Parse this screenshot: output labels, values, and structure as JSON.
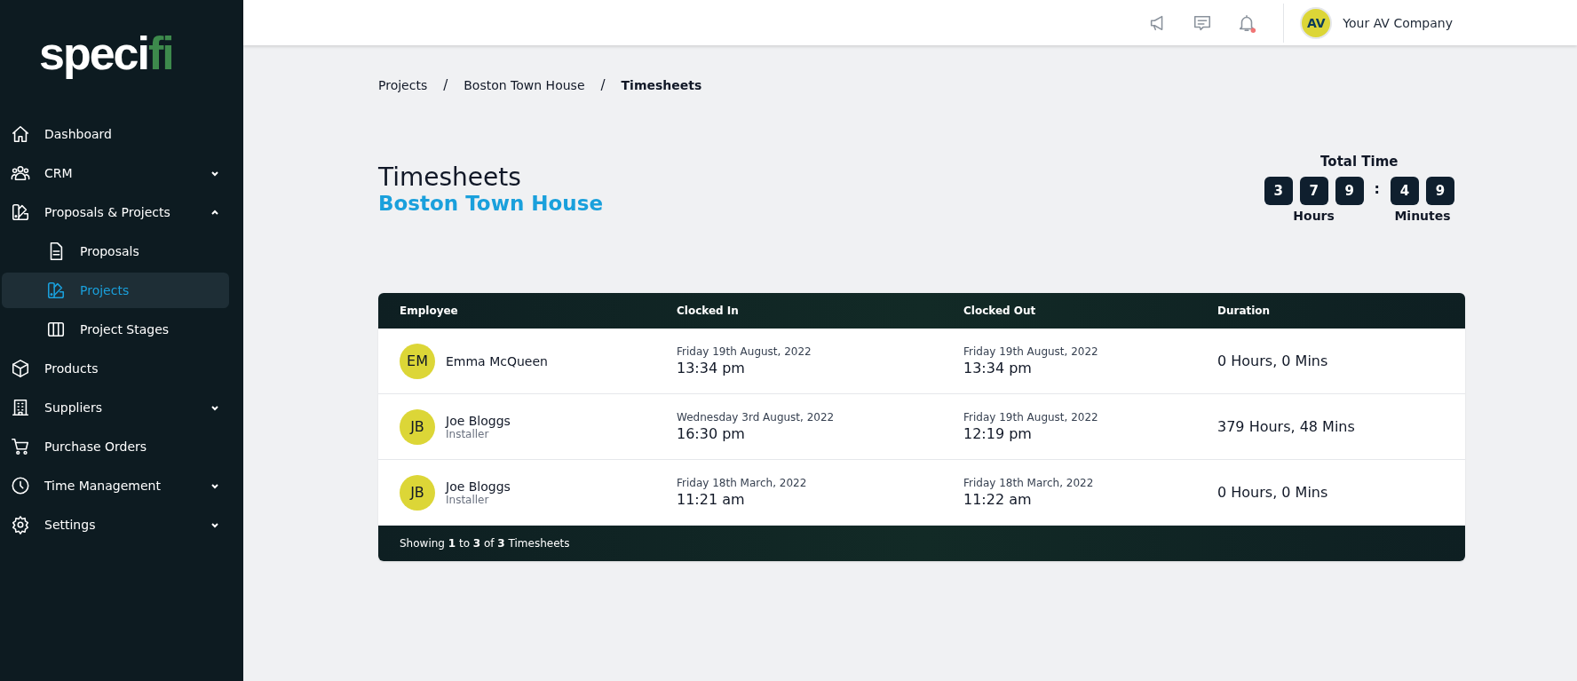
{
  "logo": {
    "text": "speci",
    "accent": "fi"
  },
  "sidebar": {
    "items": [
      {
        "label": "Dashboard",
        "kind": "home",
        "selected": false
      },
      {
        "label": "CRM",
        "kind": "users",
        "selected": false,
        "expanded": false
      },
      {
        "label": "Proposals & Projects",
        "kind": "swatch",
        "selected": false,
        "expanded": true,
        "children": [
          {
            "label": "Proposals",
            "kind": "doc",
            "selected": false
          },
          {
            "label": "Projects",
            "kind": "swatch",
            "selected": true
          },
          {
            "label": "Project Stages",
            "kind": "columns",
            "selected": false
          }
        ]
      },
      {
        "label": "Products",
        "kind": "cube",
        "selected": false
      },
      {
        "label": "Suppliers",
        "kind": "building",
        "selected": false,
        "expanded": false
      },
      {
        "label": "Purchase Orders",
        "kind": "cart",
        "selected": false
      },
      {
        "label": "Time Management",
        "kind": "clock",
        "selected": false,
        "expanded": false
      },
      {
        "label": "Settings",
        "kind": "gear",
        "selected": false,
        "expanded": false
      }
    ]
  },
  "topbar": {
    "notifications_unread": true,
    "account": {
      "initials": "AV",
      "name": "Your AV Company"
    }
  },
  "breadcrumb": [
    {
      "label": "Projects",
      "current": false
    },
    {
      "label": "Boston Town House",
      "current": false
    },
    {
      "label": "Timesheets",
      "current": true
    }
  ],
  "breadcrumb_separator": "/",
  "page": {
    "title": "Timesheets",
    "subtitle": "Boston Town House"
  },
  "total_time": {
    "title": "Total Time",
    "hours": [
      "3",
      "7",
      "9"
    ],
    "separator": ":",
    "minutes": [
      "4",
      "9"
    ],
    "hours_label": "Hours",
    "minutes_label": "Minutes"
  },
  "table": {
    "columns": [
      "Employee",
      "Clocked In",
      "Clocked Out",
      "Duration"
    ],
    "rows": [
      {
        "initials": "EM",
        "name": "Emma McQueen",
        "in_date": "Friday 19th August, 2022",
        "in_time": "13:34 pm",
        "out_date": "Friday 19th August, 2022",
        "out_time": "13:34 pm",
        "duration": "0 Hours, 0 Mins"
      },
      {
        "initials": "JB",
        "name": "Joe Bloggs",
        "role": "Installer",
        "in_date": "Wednesday 3rd August, 2022",
        "in_time": "16:30 pm",
        "out_date": "Friday 19th August, 2022",
        "out_time": "12:19 pm",
        "duration": "379 Hours, 48 Mins"
      },
      {
        "initials": "JB",
        "name": "Joe Bloggs",
        "role": "Installer",
        "in_date": "Friday 18th March, 2022",
        "in_time": "11:21 am",
        "out_date": "Friday 18th March, 2022",
        "out_time": "11:22 am",
        "duration": "0 Hours, 0 Mins"
      }
    ],
    "footer": "Showing **1** to **3** of **3** Timesheets"
  }
}
